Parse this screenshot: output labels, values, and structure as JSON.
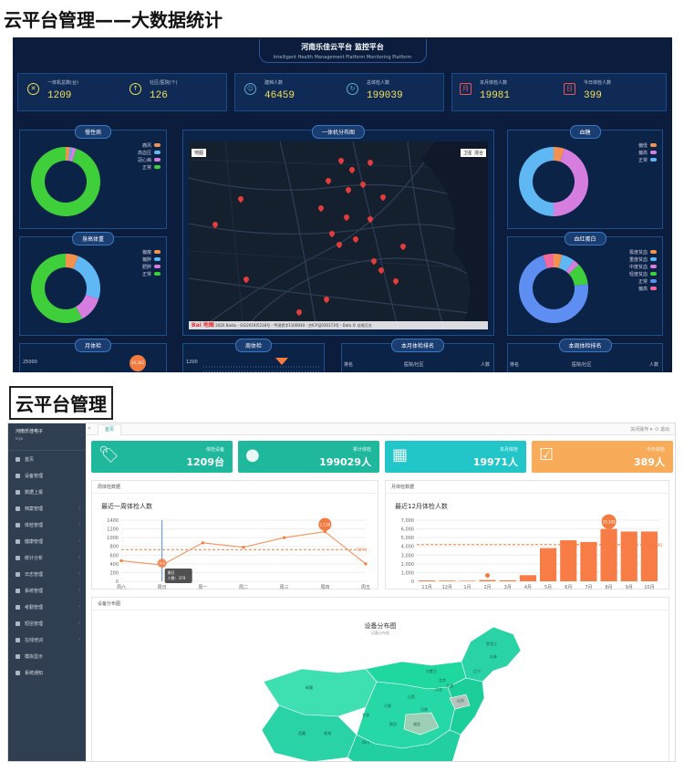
{
  "heading1": "云平台管理——大数据统计",
  "heading2": "云平台管理",
  "dashboard": {
    "title": "河南乐佳云平台 监控平台",
    "subtitle": "Intelligent Health Management Platform Monitoring Platform",
    "stats": [
      {
        "label": "一体机总数(台)",
        "value": "1209",
        "icon": "monitor-icon"
      },
      {
        "label": "社区/医院(个)",
        "value": "126",
        "icon": "upload-icon"
      },
      {
        "label": "建档人数",
        "value": "46459",
        "icon": "person-icon"
      },
      {
        "label": "总体检人数",
        "value": "199039",
        "icon": "refresh-icon"
      },
      {
        "label": "本月体检人数",
        "value": "19981",
        "icon": "month-icon"
      },
      {
        "label": "今日体检人数",
        "value": "399",
        "icon": "today-icon"
      }
    ],
    "panels": {
      "chronic": {
        "title": "慢性病",
        "legend": [
          "痛风",
          "高血压",
          "冠心病",
          "正常"
        ],
        "colors": [
          "#f3924f",
          "#5fb7f3",
          "#d57ee0",
          "#3fcf3b"
        ],
        "values": [
          2,
          1,
          2,
          95
        ]
      },
      "map": {
        "title": "一体机分布图",
        "btn_left": "地图",
        "btn_right1": "卫星",
        "btn_right2": "混合",
        "footer": "© 2020 Baidu - GS(2019)5218号 - 甲测资字1100930 - 京ICP证030173号 - Data © 长地万方",
        "baidu": "Bai 地图"
      },
      "glucose": {
        "title": "血糖",
        "legend": [
          "偏低",
          "偏高",
          "正常"
        ],
        "colors": [
          "#f3924f",
          "#d57ee0",
          "#5fb7f3"
        ],
        "values": [
          5,
          45,
          50
        ]
      },
      "body": {
        "title": "身高体重",
        "legend": [
          "偏瘦",
          "偏胖",
          "肥胖",
          "正常"
        ],
        "colors": [
          "#f3924f",
          "#5fb7f3",
          "#d57ee0",
          "#3fcf3b"
        ],
        "values": [
          6,
          24,
          12,
          58
        ]
      },
      "hemoglobin": {
        "title": "血红蛋白",
        "legend": [
          "极度贫血",
          "重度贫血",
          "中度贫血",
          "轻度贫血",
          "正常",
          "偏高"
        ],
        "colors": [
          "#f3924f",
          "#5fb7f3",
          "#d57ee0",
          "#3fcf3b",
          "#5f8ef3",
          "#f06aa0"
        ],
        "values": [
          4,
          6,
          3,
          10,
          72,
          5
        ]
      },
      "month": {
        "title": "月体检",
        "axis": "25000",
        "badge": "20,342"
      },
      "week": {
        "title": "周体检",
        "axis": "1200"
      },
      "month_rank": {
        "title": "本月体检排名",
        "cols": [
          "排名",
          "医院/社区",
          "人数"
        ]
      },
      "week_rank": {
        "title": "本周体检排名",
        "cols": [
          "排名",
          "医院/社区",
          "人数"
        ]
      }
    }
  },
  "admin": {
    "brand": "河南乐佳电子",
    "brand_sub": "lejia",
    "menu": [
      "首页",
      "设备管理",
      "数据上报",
      "档案管理",
      "体检管理",
      "健康管理",
      "统计分析",
      "日志管理",
      "系统管理",
      "考勤管理",
      "短信管理",
      "在线培训",
      "模拟显示",
      "系统通知"
    ],
    "tab": "首页",
    "top_right1": "关闭操作 ▾",
    "top_right2": "退出",
    "cards": [
      {
        "label": "体检设备",
        "value": "1209台",
        "color": "#1fb89c",
        "icon": "tag-icon"
      },
      {
        "label": "累计体检",
        "value": "199029人",
        "color": "#1fb89c",
        "icon": "user-icon"
      },
      {
        "label": "本月体检",
        "value": "19971人",
        "color": "#23c6c8",
        "icon": "calendar-icon"
      },
      {
        "label": "今日体检",
        "value": "389人",
        "color": "#f8ac59",
        "icon": "calendar-check-icon"
      }
    ],
    "week_panel": {
      "header": "周体检数据",
      "title": "最近一周体检人数",
      "tooltip_day": "周日",
      "tooltip_val": "人数：374",
      "max_label": "1,136",
      "min_label": "374",
      "avg_label": "727.1"
    },
    "month_panel": {
      "header": "月体检数据",
      "title": "最近12月体检人数",
      "max_label": "20,342",
      "avg_label": "4,203"
    },
    "dist_panel": {
      "header": "设备分布图",
      "title": "设备分布图",
      "subtitle": "设备分布图"
    },
    "map_labels": [
      "黑龙江",
      "吉林",
      "辽宁",
      "内蒙古",
      "新疆",
      "西藏",
      "青海",
      "甘肃",
      "宁夏",
      "陕西",
      "山西",
      "河北",
      "北京",
      "天津",
      "山东",
      "河南",
      "四川",
      "湖北"
    ]
  },
  "chart_data": [
    {
      "type": "line",
      "title": "最近一周体检人数",
      "categories": [
        "周六",
        "周日",
        "周一",
        "周二",
        "周三",
        "周四",
        "周五"
      ],
      "values": [
        470,
        374,
        880,
        780,
        1000,
        1136,
        400
      ],
      "ylim": [
        0,
        1400
      ],
      "yticks": [
        "0",
        "200",
        "400",
        "600",
        "800",
        "1000",
        "1200",
        "1400"
      ],
      "avg": 727.1
    },
    {
      "type": "bar",
      "title": "最近12月体检人数",
      "categories": [
        "11月",
        "12月",
        "1月",
        "2月",
        "3月",
        "4月",
        "5月",
        "6月",
        "7月",
        "8月",
        "9月",
        "10月"
      ],
      "values": [
        100,
        80,
        60,
        150,
        120,
        700,
        3800,
        4700,
        4500,
        6000,
        5700,
        5700
      ],
      "ylim": [
        0,
        7000
      ],
      "yticks": [
        "0",
        "1,000",
        "2,000",
        "3,000",
        "4,000",
        "5,000",
        "6,000",
        "7,000"
      ],
      "avg": 4203
    }
  ]
}
